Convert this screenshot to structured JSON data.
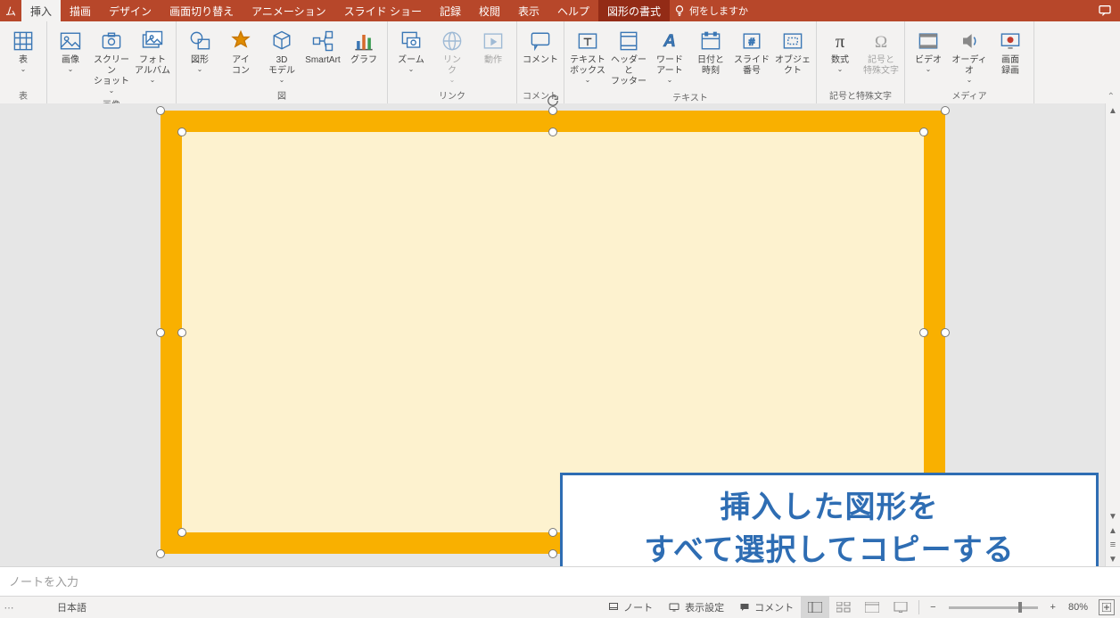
{
  "tabs": {
    "partial": "ム",
    "items": [
      "挿入",
      "描画",
      "デザイン",
      "画面切り替え",
      "アニメーション",
      "スライド ショー",
      "記録",
      "校閲",
      "表示",
      "ヘルプ"
    ],
    "context": "図形の書式",
    "tell_me": "何をしますか"
  },
  "ribbon": {
    "groups": [
      {
        "label": "表",
        "buttons": [
          {
            "k": "table",
            "label": "表",
            "drop": true
          }
        ]
      },
      {
        "label": "画像",
        "buttons": [
          {
            "k": "image",
            "label": "画像",
            "drop": true
          },
          {
            "k": "screenshot",
            "label": "スクリーン\nショット",
            "drop": true
          },
          {
            "k": "album",
            "label": "フォト\nアルバム",
            "drop": true
          }
        ]
      },
      {
        "label": "図",
        "buttons": [
          {
            "k": "shapes",
            "label": "図形",
            "drop": true
          },
          {
            "k": "icons",
            "label": "アイ\nコン"
          },
          {
            "k": "3d",
            "label": "3D\nモデル",
            "drop": true
          },
          {
            "k": "smartart",
            "label": "SmartArt"
          },
          {
            "k": "chart",
            "label": "グラフ"
          }
        ]
      },
      {
        "label": "リンク",
        "buttons": [
          {
            "k": "zoom",
            "label": "ズーム",
            "drop": true
          },
          {
            "k": "link",
            "label": "リン\nク",
            "drop": true,
            "disabled": true
          },
          {
            "k": "action",
            "label": "動作",
            "disabled": true
          }
        ]
      },
      {
        "label": "コメント",
        "buttons": [
          {
            "k": "comment",
            "label": "コメント"
          }
        ]
      },
      {
        "label": "テキスト",
        "buttons": [
          {
            "k": "textbox",
            "label": "テキスト\nボックス",
            "drop": true
          },
          {
            "k": "headerfooter",
            "label": "ヘッダーと\nフッター"
          },
          {
            "k": "wordart",
            "label": "ワード\nアート",
            "drop": true
          },
          {
            "k": "datetime",
            "label": "日付と\n時刻"
          },
          {
            "k": "slidenum",
            "label": "スライド番号"
          },
          {
            "k": "object",
            "label": "オブジェクト"
          }
        ]
      },
      {
        "label": "記号と特殊文字",
        "buttons": [
          {
            "k": "equation",
            "label": "数式",
            "drop": true
          },
          {
            "k": "symbol",
            "label": "記号と\n特殊文字",
            "disabled": true
          }
        ]
      },
      {
        "label": "メディア",
        "buttons": [
          {
            "k": "video",
            "label": "ビデオ",
            "drop": true
          },
          {
            "k": "audio",
            "label": "オーディオ",
            "drop": true
          },
          {
            "k": "screenrec",
            "label": "画面\n録画"
          }
        ]
      }
    ]
  },
  "callout": {
    "line1": "挿入した図形を",
    "line2": "すべて選択してコピーする"
  },
  "notes": {
    "placeholder": "ノートを入力"
  },
  "status": {
    "language": "日本語",
    "notes_btn": "ノート",
    "display_btn": "表示設定",
    "comment_btn": "コメント",
    "zoom": "80%",
    "minus": "−",
    "plus": "+"
  }
}
